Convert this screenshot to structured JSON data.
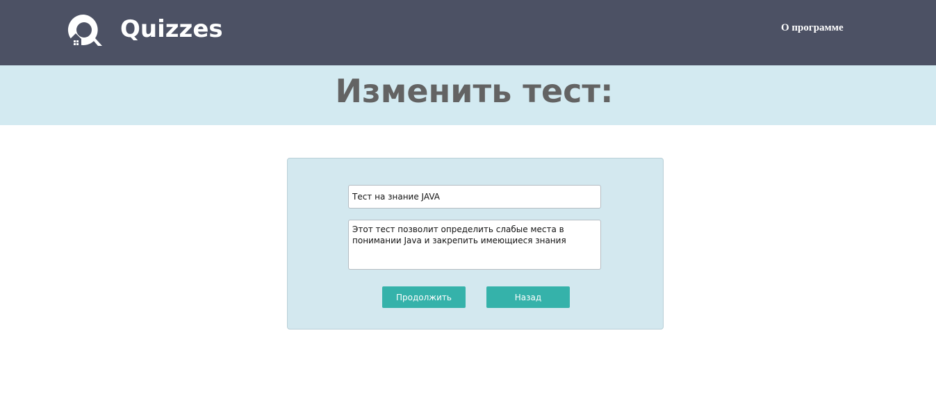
{
  "header": {
    "brand": "Quizzes",
    "logo_icon": "quizzes-logo-icon",
    "nav_about": "О программе",
    "background_color": "#4c5164"
  },
  "banner": {
    "title": "Изменить тест:",
    "background_color": "#d3eaf1"
  },
  "form": {
    "title_value": "Тест на знание JAVA",
    "description_value": "Этот тест позволит определить слабые места в понимании Java и закрепить имеющиеся знания",
    "continue_label": "Продолжить",
    "back_label": "Назад",
    "button_color": "#35b2aa"
  }
}
